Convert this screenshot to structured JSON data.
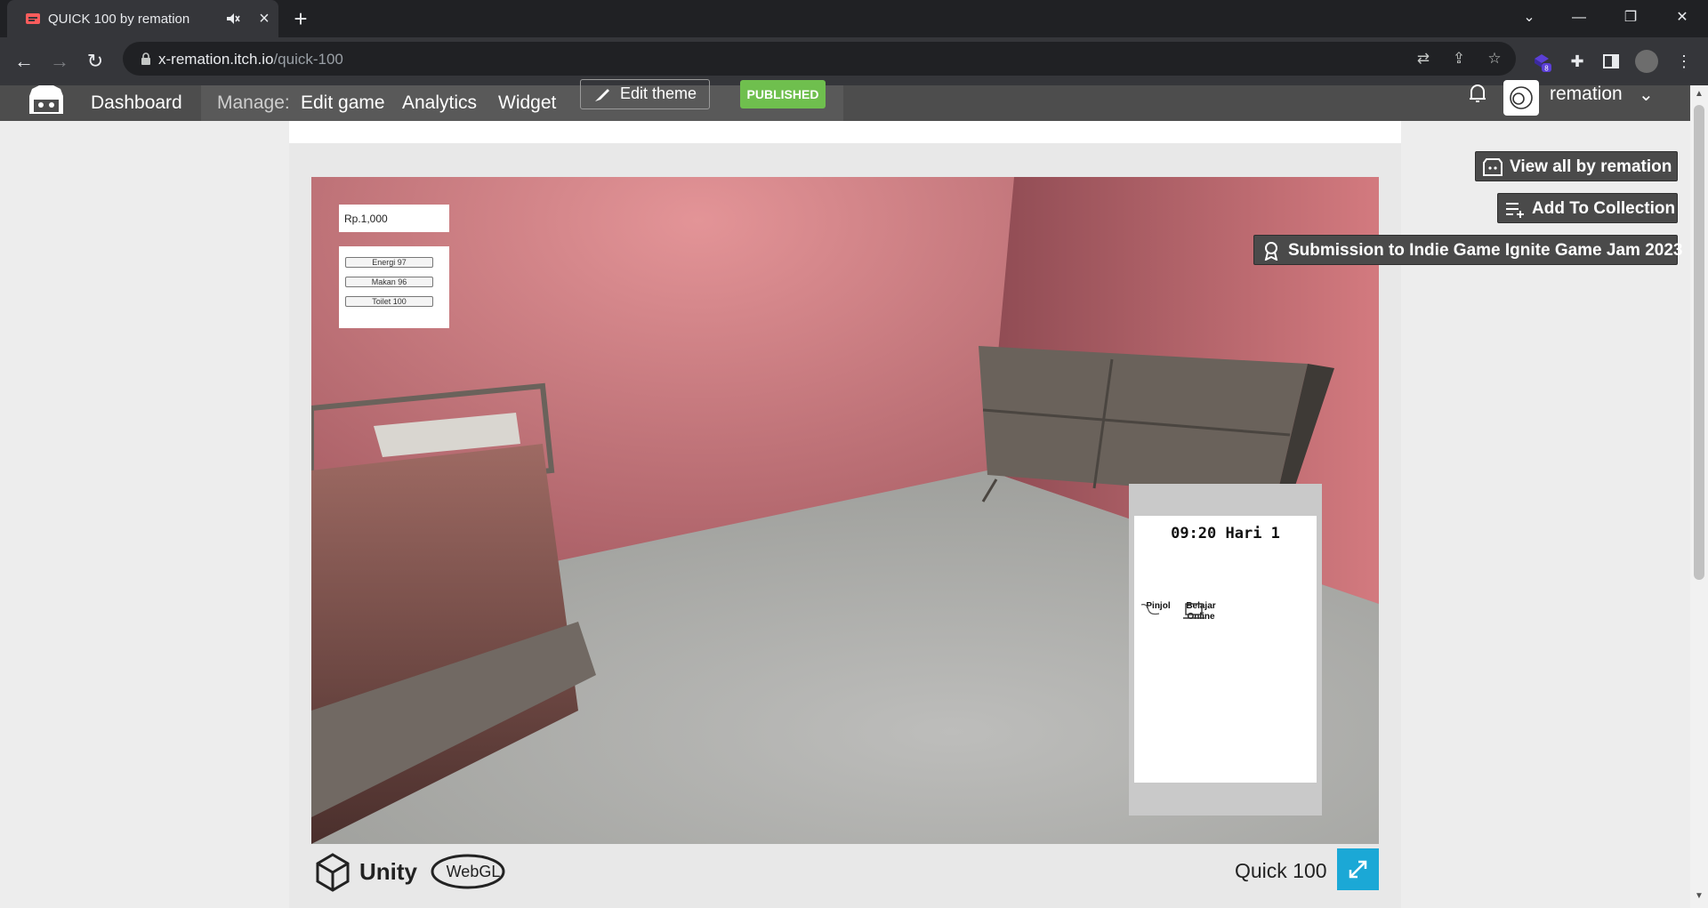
{
  "browser": {
    "tab_title": "QUICK 100 by remation",
    "url_host": "x-remation.itch.io",
    "url_path": "/quick-100",
    "extension_badge": "8"
  },
  "itch_header": {
    "dashboard": "Dashboard",
    "manage_label": "Manage:",
    "edit_game": "Edit game",
    "analytics": "Analytics",
    "widget": "Widget",
    "edit_theme": "Edit theme",
    "published": "PUBLISHED",
    "username": "remation"
  },
  "side_buttons": {
    "view_all": "View all by remation",
    "add_collection": "Add To Collection",
    "submission": "Submission to Indie Game Ignite Game Jam 2023"
  },
  "game": {
    "money": "Rp.1,000",
    "stats": [
      {
        "label": "Energi 97",
        "value": 97
      },
      {
        "label": "Makan 96",
        "value": 96
      },
      {
        "label": "Toilet 100",
        "value": 100
      }
    ],
    "phone": {
      "time": "09:20 Hari 1",
      "apps": [
        {
          "label": "Pinjol"
        },
        {
          "label": "Belajar Online"
        }
      ]
    }
  },
  "player_footer": {
    "unity": "Unity",
    "webgl": "WebGL",
    "game_title": "Quick 100"
  },
  "colors": {
    "itch_header": "#4d4d4d",
    "published_green": "#6fbf4e",
    "fullscreen_blue": "#1ba8d6",
    "wall": "#b97479"
  }
}
